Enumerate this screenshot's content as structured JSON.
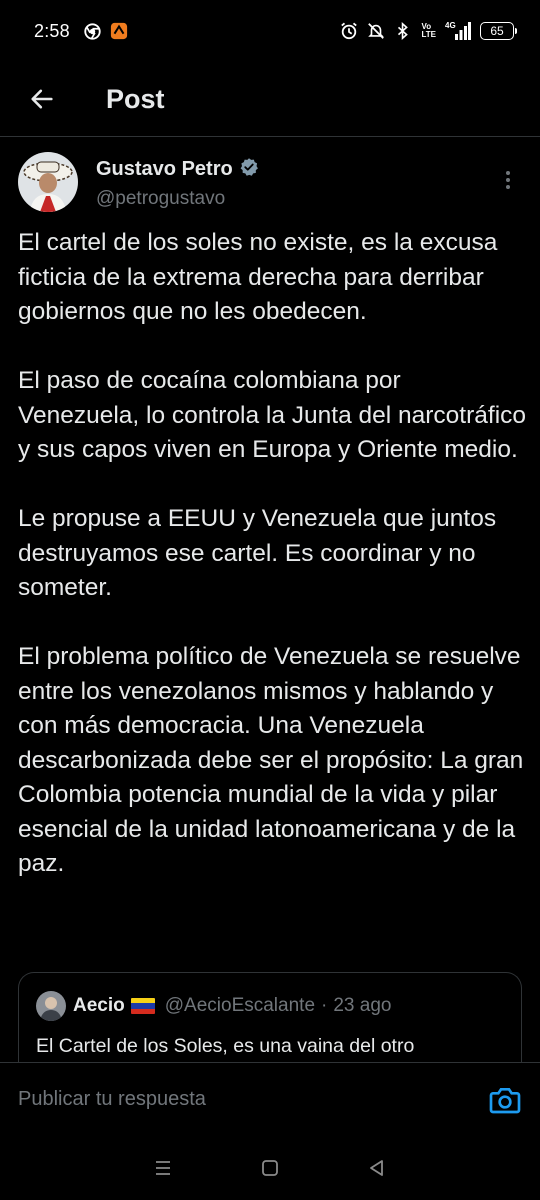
{
  "status_bar": {
    "time": "2:58",
    "network_top": "Vo",
    "network_bottom": "LTE",
    "signal_label": "4G",
    "battery": "65"
  },
  "appbar": {
    "title": "Post"
  },
  "author": {
    "display_name": "Gustavo Petro",
    "handle": "@petrogustavo",
    "verified_color": "#829aab"
  },
  "post": {
    "paragraphs": [
      "El cartel de los soles no existe, es la excusa ficticia de la extrema derecha para derribar gobiernos que no les obedecen.",
      "El paso de cocaína colombiana por Venezuela, lo controla la Junta del narcotráfico y sus capos viven en Europa y Oriente medio.",
      "Le propuse a EEUU y Venezuela que juntos destruyamos ese cartel. Es coordinar y no someter.",
      "El problema político de Venezuela se resuelve entre los venezolanos mismos y hablando y con más democracia. Una Venezuela descarbonizada debe ser el propósito: La gran Colombia potencia mundial de la vida y pilar esencial de la unidad latonoamericana y de la paz."
    ]
  },
  "quote": {
    "name": "Aecio",
    "flag": "Venezuela flag",
    "handle": "@AecioEscalante",
    "separator": "·",
    "time": "23 ago",
    "text": "El Cartel de los Soles, es una vaina del otro"
  },
  "composer": {
    "placeholder": "Publicar tu respuesta"
  },
  "colors": {
    "background": "#000000",
    "text": "#e7e9ea",
    "secondary": "#71767b",
    "divider": "#2f3336",
    "accent": "#1d9bf0"
  },
  "icons": {
    "back": "arrow-left-icon",
    "more": "more-vertical-icon",
    "verified": "verified-badge-icon",
    "camera": "camera-icon"
  }
}
